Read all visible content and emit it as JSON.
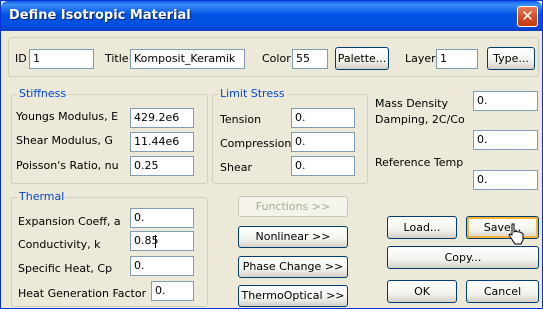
{
  "window": {
    "title": "Define Isotropic Material",
    "close_glyph": "✕"
  },
  "header": {
    "id_label": "ID",
    "id_value": "1",
    "title_label": "Title",
    "title_value": "Komposit_Keramik",
    "color_label": "Color",
    "color_value": "55",
    "palette_button": "Palette...",
    "layer_label": "Layer",
    "layer_value": "1",
    "type_button": "Type..."
  },
  "stiffness": {
    "group_label": "Stiffness",
    "youngs_label": "Youngs Modulus, E",
    "youngs_value": "429.2e6",
    "shear_label": "Shear Modulus, G",
    "shear_value": "11.44e6",
    "poisson_label": "Poisson's Ratio, nu",
    "poisson_value": "0.25"
  },
  "limit_stress": {
    "group_label": "Limit Stress",
    "tension_label": "Tension",
    "tension_value": "0.",
    "compression_label": "Compression",
    "compression_value": "0.",
    "shear_label": "Shear",
    "shear_value": "0."
  },
  "right_panel": {
    "mass_density_label": "Mass Density",
    "mass_density_value": "0.",
    "damping_label": "Damping, 2C/Co",
    "damping_value": "0.",
    "reference_temp_label": "Reference Temp",
    "reference_temp_value": "0."
  },
  "thermal": {
    "group_label": "Thermal",
    "expansion_label": "Expansion Coeff, a",
    "expansion_value": "0.",
    "conductivity_label": "Conductivity, k",
    "conductivity_value": "0.85",
    "specific_heat_label": "Specific Heat, Cp",
    "specific_heat_value": "0.",
    "heat_gen_label": "Heat Generation Factor",
    "heat_gen_value": "0."
  },
  "buttons": {
    "functions": "Functions >>",
    "nonlinear": "Nonlinear >>",
    "phase_change": "Phase Change >>",
    "thermo_optical": "ThermoOptical >>",
    "load": "Load...",
    "save": "Save...",
    "copy": "Copy...",
    "ok": "OK",
    "cancel": "Cancel"
  },
  "colors": {
    "titlebar": "#0054e3",
    "group_label": "#0046d5",
    "dialog_bg": "#ece9d8"
  },
  "icons": {
    "close": "close-icon",
    "cursor": "mouse-pointer-icon"
  }
}
